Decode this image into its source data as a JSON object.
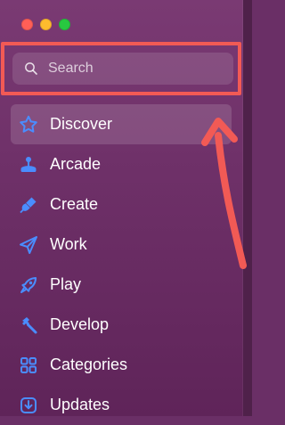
{
  "window": {
    "controls": [
      "close",
      "minimize",
      "zoom"
    ],
    "accent": "#7a3a73"
  },
  "search": {
    "placeholder": "Search",
    "value": ""
  },
  "sidebar": {
    "items": [
      {
        "label": "Discover",
        "icon": "star-icon",
        "selected": true
      },
      {
        "label": "Arcade",
        "icon": "joystick-icon",
        "selected": false
      },
      {
        "label": "Create",
        "icon": "paintbrush-icon",
        "selected": false
      },
      {
        "label": "Work",
        "icon": "paper-plane-icon",
        "selected": false
      },
      {
        "label": "Play",
        "icon": "rocket-icon",
        "selected": false
      },
      {
        "label": "Develop",
        "icon": "hammer-icon",
        "selected": false
      },
      {
        "label": "Categories",
        "icon": "grid-icon",
        "selected": false
      },
      {
        "label": "Updates",
        "icon": "download-box-icon",
        "selected": false
      }
    ]
  },
  "annotation": {
    "highlight_color": "#f25a55",
    "arrow_color": "#f25a55"
  }
}
